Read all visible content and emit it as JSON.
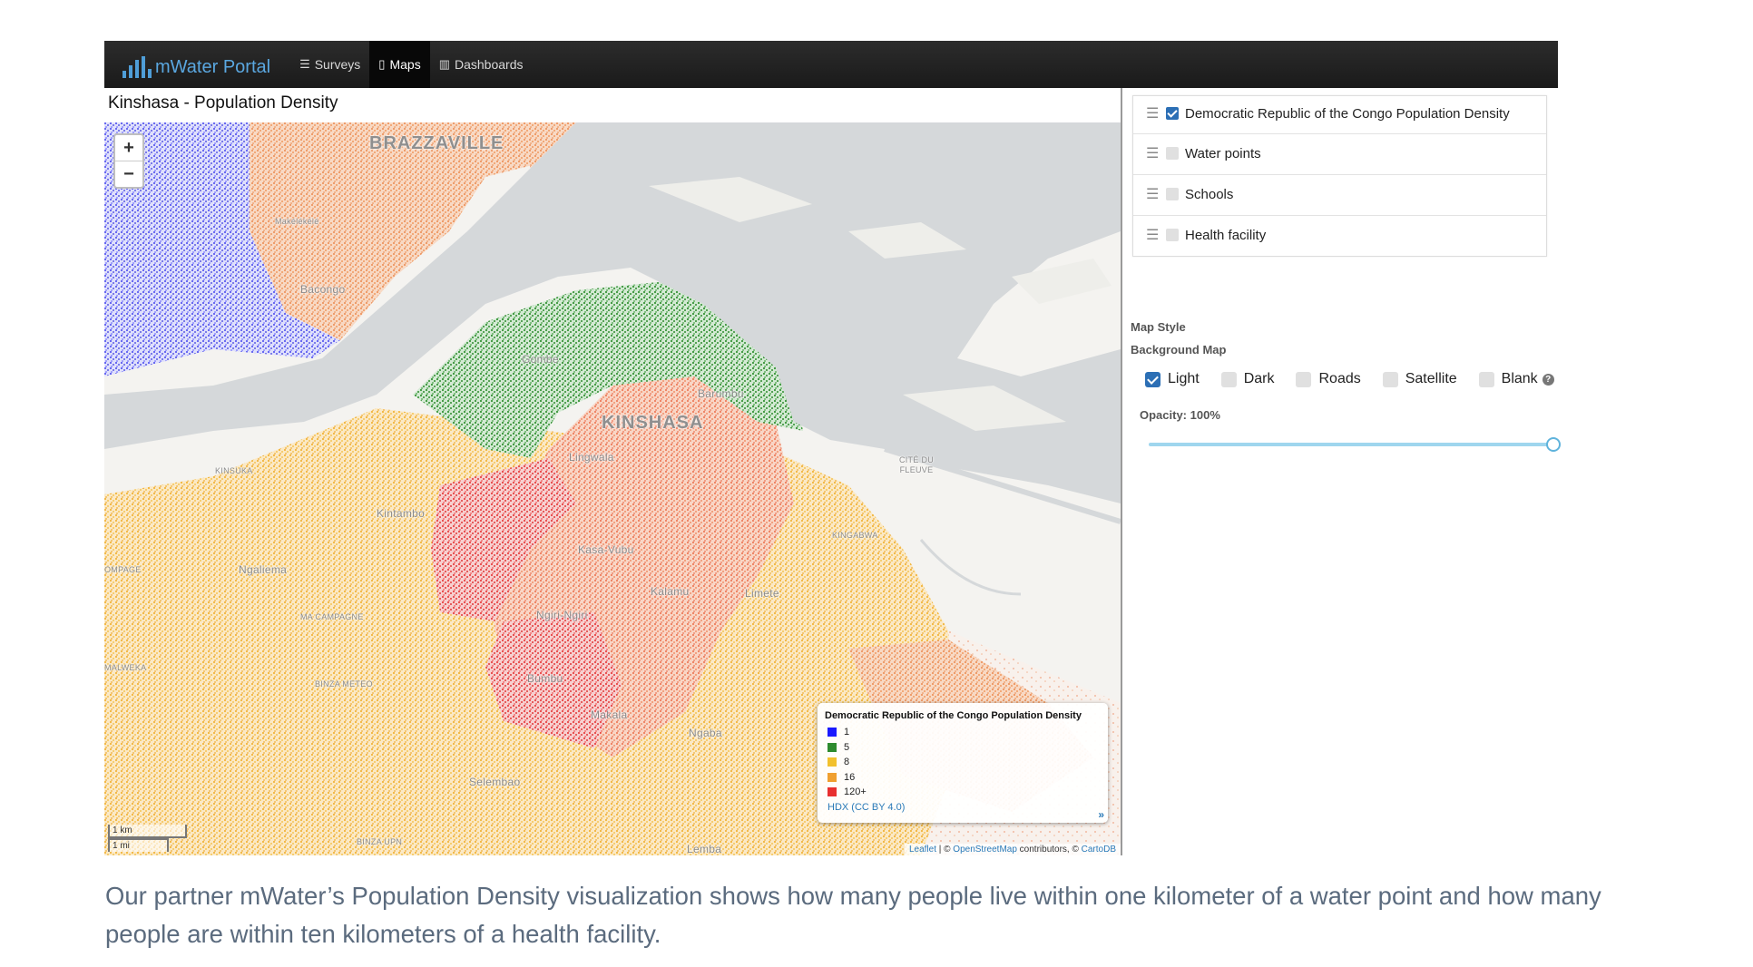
{
  "navbar": {
    "brand": "mWater Portal",
    "items": [
      {
        "icon": "list-icon",
        "glyph": "☰",
        "label": "Surveys",
        "active": false
      },
      {
        "icon": "map-icon",
        "glyph": "▯",
        "label": "Maps",
        "active": true
      },
      {
        "icon": "bar-chart-icon",
        "glyph": "▥",
        "label": "Dashboards",
        "active": false
      }
    ]
  },
  "map": {
    "title": "Kinshasa - Population Density",
    "zoom_in": "+",
    "zoom_out": "−",
    "labels": {
      "brazzaville": "BRAZZAVILLE",
      "kinshasa": "KINSHASA",
      "gombe": "Gombe",
      "barumbu": "Barumbu",
      "lingwala": "Lingwala",
      "kinsuka": "KINSUKA",
      "cite_du_fleuve": "CITÉ DU FLEUVE",
      "kintambo": "Kintambo",
      "ngaliema": "Ngaliema",
      "kasa_vubu": "Kasa-Vubu",
      "kalamu": "Kalamu",
      "limete": "Limete",
      "ngiri_ngiri": "Ngiri-Ngiri",
      "ma_campagne": "MA CAMPAGNE",
      "binza_meteo": "BINZA METEO",
      "bumbu": "Bumbu",
      "makala": "Makala",
      "ngaba": "Ngaba",
      "selembao": "Selembao",
      "binza_upn": "BINZA UPN",
      "lemba": "Lemba",
      "kingabwa": "KINGABWA",
      "bacongo": "Bacongo",
      "mfilou": "Makélékélé",
      "campa": "OMPAGE",
      "malweka": "MALWEKA"
    },
    "scale": {
      "km": "1 km",
      "mi": "1 mi"
    },
    "attribution": {
      "leaflet": "Leaflet",
      "sep": " | © ",
      "osm": "OpenStreetMap",
      "contrib": " contributors, © ",
      "carto": "CartoDB"
    }
  },
  "legend": {
    "title": "Democratic Republic of the Congo Population Density",
    "entries": [
      {
        "label": "1",
        "color": "#1a1aff"
      },
      {
        "label": "5",
        "color": "#2e8b2e"
      },
      {
        "label": "8",
        "color": "#f2c12e"
      },
      {
        "label": "16",
        "color": "#f0a030"
      },
      {
        "label": "120+",
        "color": "#e83030"
      }
    ],
    "source": "HDX (CC BY 4.0)",
    "toggle": "»"
  },
  "layers": [
    {
      "label": "Democratic Republic of the Congo Population Density",
      "checked": true
    },
    {
      "label": "Water points",
      "checked": false
    },
    {
      "label": "Schools",
      "checked": false
    },
    {
      "label": "Health facility",
      "checked": false
    }
  ],
  "map_style": {
    "title": "Map Style",
    "background_title": "Background Map",
    "options": [
      {
        "label": "Light",
        "checked": true
      },
      {
        "label": "Dark",
        "checked": false
      },
      {
        "label": "Roads",
        "checked": false
      },
      {
        "label": "Satellite",
        "checked": false
      },
      {
        "label": "Blank",
        "checked": false,
        "help": "?"
      }
    ],
    "opacity_label": "Opacity: 100%",
    "opacity": 1.0
  },
  "caption": "Our partner mWater’s Population Density visualization shows how many people live within one kilometer of a water point and how many people are within ten kilometers of a health facility.",
  "colors": {
    "navbar": "#1a1a1a",
    "brand": "#5aa7e0",
    "accent": "#2c6fb5",
    "water": "#d4d7d9",
    "land": "#f4f3f0"
  }
}
